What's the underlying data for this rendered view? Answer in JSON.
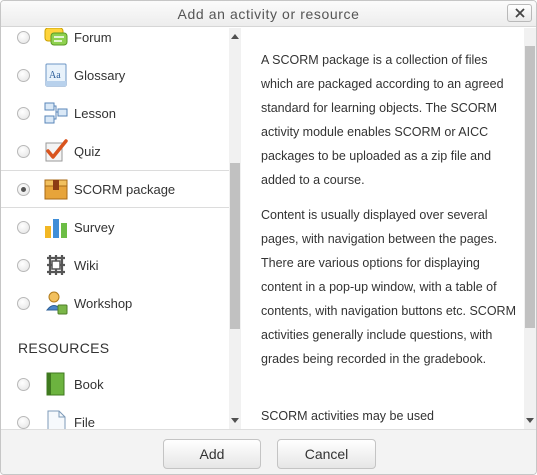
{
  "dialog": {
    "title": "Add an activity or resource",
    "close_icon": "close-icon"
  },
  "activities": [
    {
      "label": "Forum",
      "icon": "forum-icon",
      "selected": false
    },
    {
      "label": "Glossary",
      "icon": "glossary-icon",
      "selected": false
    },
    {
      "label": "Lesson",
      "icon": "lesson-icon",
      "selected": false
    },
    {
      "label": "Quiz",
      "icon": "quiz-icon",
      "selected": false
    },
    {
      "label": "SCORM package",
      "icon": "scorm-package-icon",
      "selected": true
    },
    {
      "label": "Survey",
      "icon": "survey-icon",
      "selected": false
    },
    {
      "label": "Wiki",
      "icon": "wiki-icon",
      "selected": false
    },
    {
      "label": "Workshop",
      "icon": "workshop-icon",
      "selected": false
    }
  ],
  "resources_heading": "RESOURCES",
  "resources": [
    {
      "label": "Book",
      "icon": "book-icon",
      "selected": false
    },
    {
      "label": "File",
      "icon": "file-icon",
      "selected": false
    }
  ],
  "description": [
    "A SCORM package is a collection of files which are packaged according to an agreed standard for learning objects. The SCORM activity module enables SCORM or AICC packages to be uploaded as a zip file and added to a course.",
    "Content is usually displayed over several pages, with navigation between the pages. There are various options for displaying content in a pop-up window, with a table of contents, with navigation buttons etc. SCORM activities generally include questions, with grades being recorded in the gradebook.",
    "SCORM activities may be used"
  ],
  "footer": {
    "add_label": "Add",
    "cancel_label": "Cancel"
  }
}
